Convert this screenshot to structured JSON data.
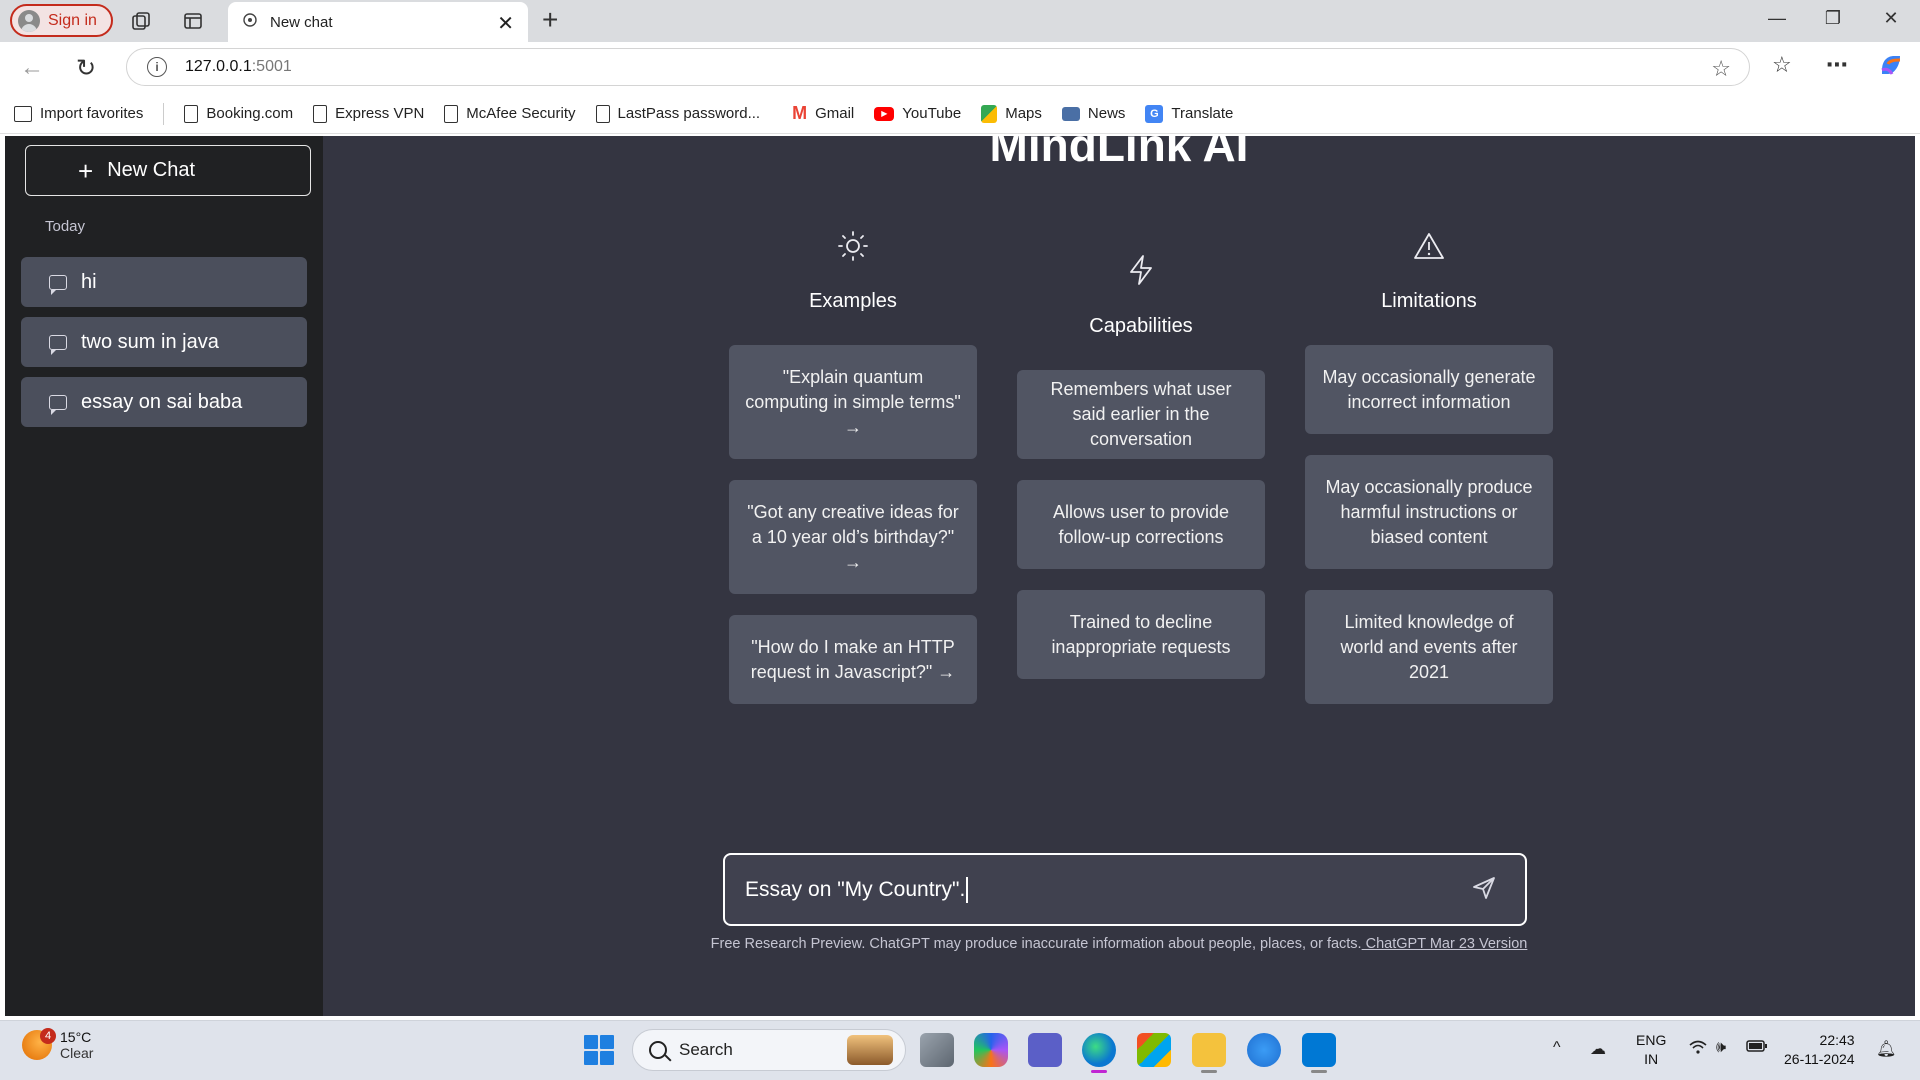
{
  "browser": {
    "signin_label": "Sign in",
    "tab_title": "New chat",
    "url_host": "127.0.0.1",
    "url_port": ":5001",
    "favorites": [
      {
        "label": "Import favorites",
        "icon": "import-icon"
      },
      {
        "label": "Booking.com",
        "icon": "page-icon"
      },
      {
        "label": "Express VPN",
        "icon": "page-icon"
      },
      {
        "label": "McAfee Security",
        "icon": "page-icon"
      },
      {
        "label": "LastPass password...",
        "icon": "page-icon"
      },
      {
        "label": "Gmail",
        "icon": "gmail-icon"
      },
      {
        "label": "YouTube",
        "icon": "youtube-icon"
      },
      {
        "label": "Maps",
        "icon": "maps-icon"
      },
      {
        "label": "News",
        "icon": "news-icon"
      },
      {
        "label": "Translate",
        "icon": "translate-icon"
      }
    ]
  },
  "sidebar": {
    "new_chat_label": "New Chat",
    "section_label": "Today",
    "items": [
      {
        "label": "hi"
      },
      {
        "label": "two sum in java"
      },
      {
        "label": "essay on sai baba"
      }
    ]
  },
  "main": {
    "title": "MindLink AI",
    "columns": [
      {
        "heading": "Examples",
        "icon": "sun-icon",
        "cards": [
          "\"Explain quantum computing in simple terms\" →",
          "\"Got any creative ideas for a 10 year old’s birthday?\" →",
          "\"How do I make an HTTP request in Javascript?\" →"
        ]
      },
      {
        "heading": "Capabilities",
        "icon": "lightning-icon",
        "cards": [
          "Remembers what user said earlier in the conversation",
          "Allows user to provide follow-up corrections",
          "Trained to decline inappropriate requests"
        ]
      },
      {
        "heading": "Limitations",
        "icon": "warning-icon",
        "cards": [
          "May occasionally generate incorrect information",
          "May occasionally produce harmful instructions or biased content",
          "Limited knowledge of world and events after 2021"
        ]
      }
    ],
    "input_value": "Essay on \"My Country\".",
    "footer_text": "Free Research Preview. ChatGPT may produce inaccurate information about people, places, or facts.",
    "footer_link": " ChatGPT Mar 23 Version"
  },
  "taskbar": {
    "weather_badge": "4",
    "temperature": "15°C",
    "condition": "Clear",
    "search_label": "Search",
    "lang_line1": "ENG",
    "lang_line2": "IN",
    "time": "22:43",
    "date": "26-11-2024"
  },
  "colors": {
    "sidebar_bg": "#202123",
    "main_bg": "#343541",
    "card_bg": "#515563",
    "chat_item_bg": "#4b4f5c",
    "input_bg": "#40414f",
    "signin_red": "#c42b1c"
  }
}
